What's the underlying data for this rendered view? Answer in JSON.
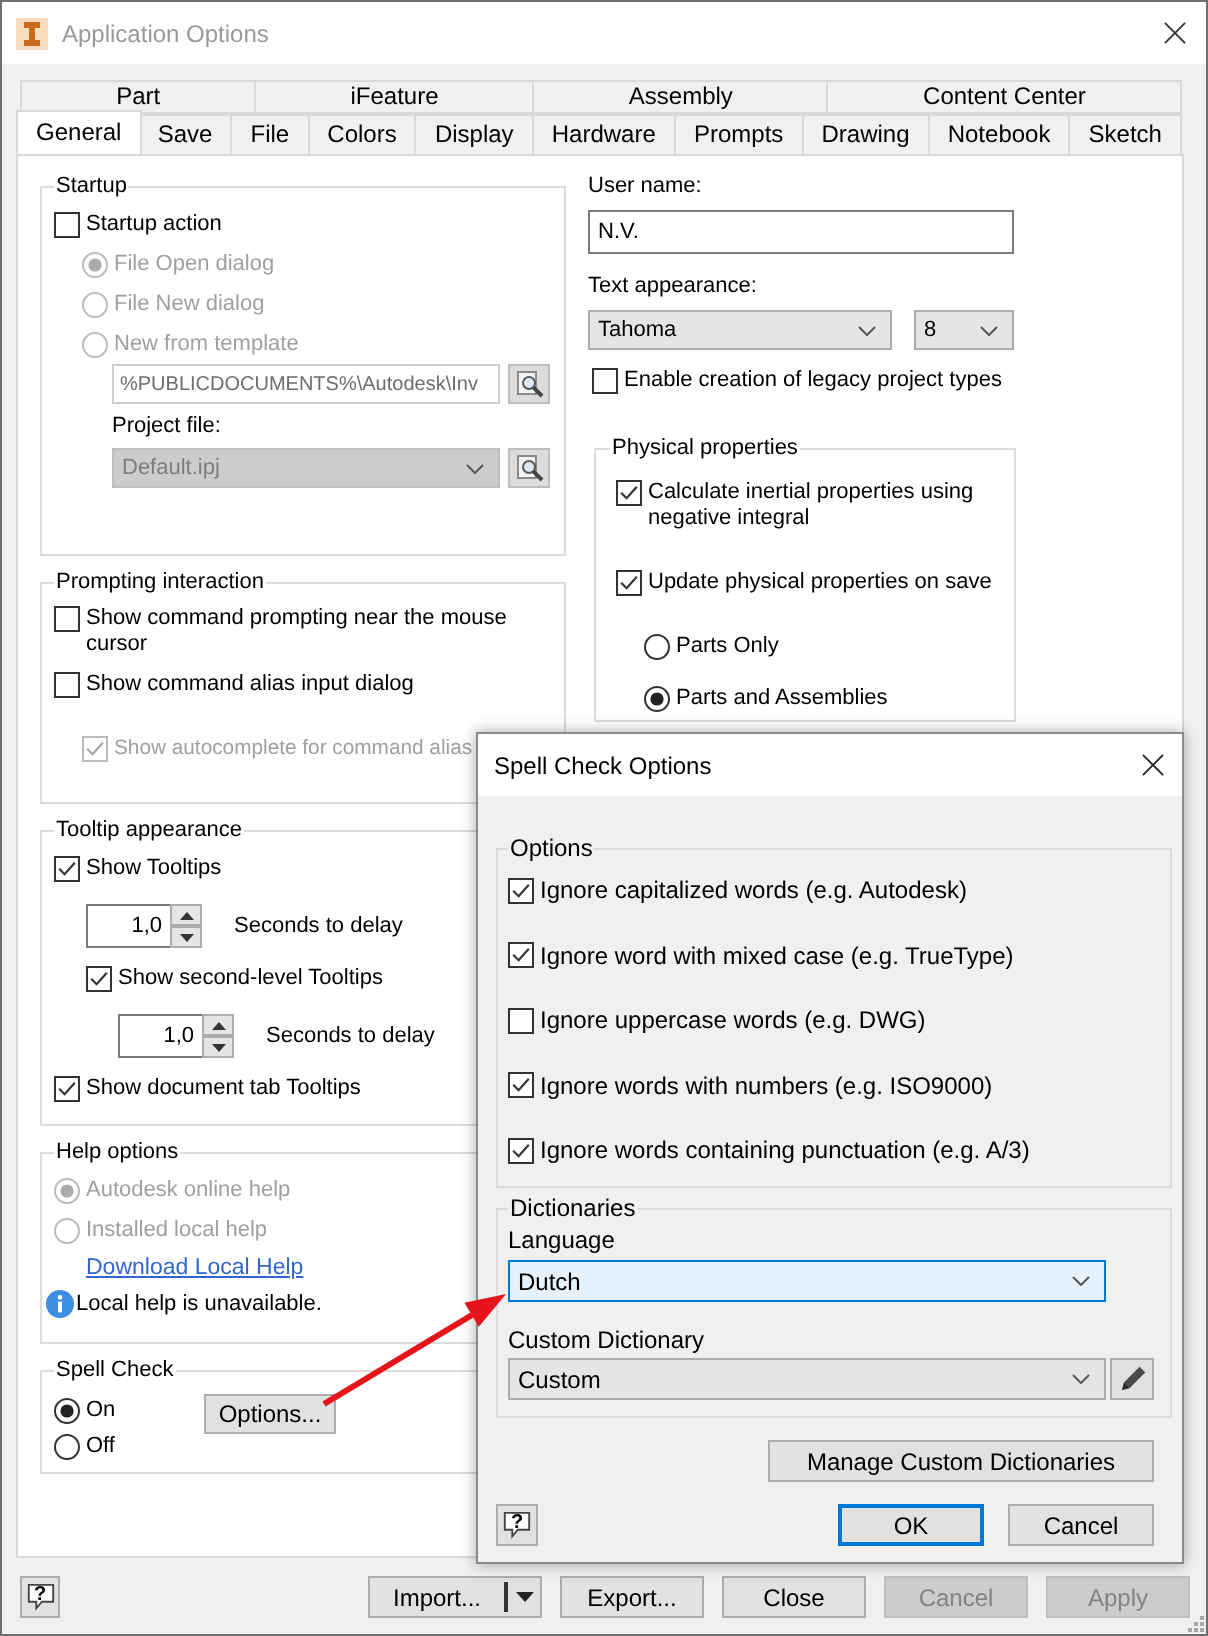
{
  "window": {
    "title": "Application Options"
  },
  "tab_rows": [
    {
      "tabs": [
        {
          "label": "Part",
          "selected": false
        },
        {
          "label": "iFeature",
          "selected": false
        },
        {
          "label": "Assembly",
          "selected": false
        },
        {
          "label": "Content Center",
          "selected": false
        }
      ]
    },
    {
      "tabs": [
        {
          "label": "General",
          "selected": true
        },
        {
          "label": "Save",
          "selected": false
        },
        {
          "label": "File",
          "selected": false
        },
        {
          "label": "Colors",
          "selected": false
        },
        {
          "label": "Display",
          "selected": false
        },
        {
          "label": "Hardware",
          "selected": false
        },
        {
          "label": "Prompts",
          "selected": false
        },
        {
          "label": "Drawing",
          "selected": false
        },
        {
          "label": "Notebook",
          "selected": false
        },
        {
          "label": "Sketch",
          "selected": false
        }
      ]
    }
  ],
  "startup": {
    "title": "Startup",
    "action": {
      "label": "Startup action",
      "checked": false
    },
    "options": [
      {
        "label": "File Open dialog",
        "selected": true,
        "disabled": true
      },
      {
        "label": "File New dialog",
        "selected": false,
        "disabled": true
      },
      {
        "label": "New from template",
        "selected": false,
        "disabled": true
      }
    ],
    "template_path": {
      "value": "%PUBLICDOCUMENTS%\\Autodesk\\Inv",
      "disabled": true
    },
    "project_file": {
      "label": "Project file:",
      "value": "Default.ipj",
      "disabled": true
    }
  },
  "prompting": {
    "title": "Prompting interaction",
    "options": [
      {
        "label": "Show command prompting near the mouse cursor",
        "checked": false,
        "disabled": false
      },
      {
        "label": "Show command alias input dialog",
        "checked": false,
        "disabled": false,
        "children": [
          {
            "label": "Show autocomplete for command alias",
            "checked": true,
            "disabled": true
          }
        ]
      }
    ]
  },
  "tooltips": {
    "title": "Tooltip appearance",
    "show_tooltips": {
      "label": "Show Tooltips",
      "checked": true
    },
    "delay": {
      "value": "1,0",
      "label": "Seconds to delay"
    },
    "second_level": {
      "label": "Show second-level Tooltips",
      "checked": true
    },
    "second_level_delay": {
      "value": "1,0",
      "label": "Seconds to delay"
    },
    "document_tabs": {
      "label": "Show document tab Tooltips",
      "checked": true
    }
  },
  "help": {
    "title": "Help options",
    "options": [
      {
        "label": "Autodesk online help",
        "selected": true,
        "disabled": true
      },
      {
        "label": "Installed local help",
        "selected": false,
        "disabled": true
      }
    ],
    "link": "Download Local Help",
    "notice": "Local help is unavailable."
  },
  "spell_check": {
    "title": "Spell Check",
    "options": [
      {
        "label": "On",
        "selected": true
      },
      {
        "label": "Off",
        "selected": false
      }
    ],
    "button": "Options..."
  },
  "user_name": {
    "label": "User name:",
    "value": "N.V."
  },
  "text_appearance": {
    "label": "Text appearance:",
    "font": "Tahoma",
    "size": "8"
  },
  "legacy_projects": {
    "label": "Enable creation of legacy project types",
    "checked": false
  },
  "physical_properties": {
    "title": "Physical properties",
    "options": [
      {
        "label": "Calculate inertial properties using negative integral",
        "checked": true
      },
      {
        "label": "Update physical properties on save",
        "checked": true
      }
    ],
    "scope": [
      {
        "label": "Parts Only",
        "selected": false
      },
      {
        "label": "Parts and Assemblies",
        "selected": true
      }
    ]
  },
  "footer": {
    "help_button": "?",
    "buttons": [
      {
        "label": "Import...",
        "kind": "split",
        "disabled": false
      },
      {
        "label": "Export...",
        "kind": "plain",
        "disabled": false
      },
      {
        "label": "Close",
        "kind": "plain",
        "disabled": false
      },
      {
        "label": "Cancel",
        "kind": "plain",
        "disabled": true
      },
      {
        "label": "Apply",
        "kind": "plain",
        "disabled": true
      }
    ]
  },
  "spell_dialog": {
    "title": "Spell Check Options",
    "options": {
      "title": "Options",
      "items": [
        {
          "label": "Ignore capitalized words (e.g. Autodesk)",
          "checked": true
        },
        {
          "label": "Ignore word with mixed case (e.g. TrueType)",
          "checked": true
        },
        {
          "label": "Ignore uppercase words (e.g. DWG)",
          "checked": false
        },
        {
          "label": "Ignore words with numbers (e.g. ISO9000)",
          "checked": true
        },
        {
          "label": "Ignore words containing punctuation (e.g. A/3)",
          "checked": true
        }
      ]
    },
    "dictionaries": {
      "title": "Dictionaries",
      "language": {
        "label": "Language",
        "value": "Dutch",
        "focused": true
      },
      "custom_dictionary": {
        "label": "Custom Dictionary",
        "value": "Custom"
      }
    },
    "manage_button": "Manage Custom Dictionaries",
    "help_button": "?",
    "buttons": [
      {
        "label": "OK",
        "default": true
      },
      {
        "label": "Cancel",
        "default": false
      }
    ]
  }
}
